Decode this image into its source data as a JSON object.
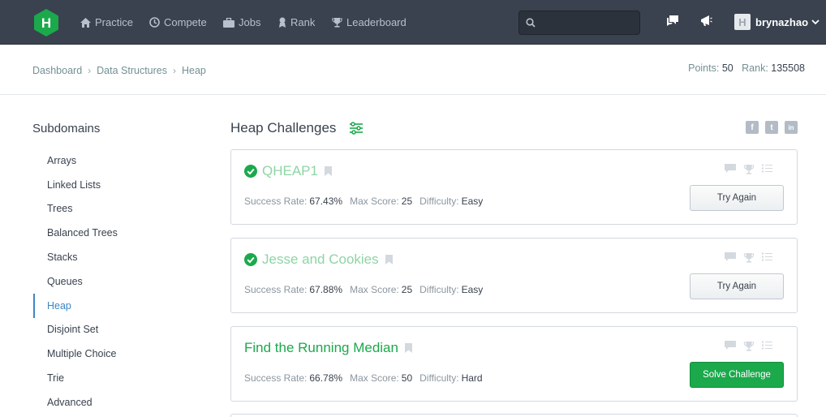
{
  "nav": {
    "logo_letter": "H",
    "items": [
      {
        "label": "Practice",
        "icon": "home-icon"
      },
      {
        "label": "Compete",
        "icon": "clock-icon"
      },
      {
        "label": "Jobs",
        "icon": "briefcase-icon"
      },
      {
        "label": "Rank",
        "icon": "rank-icon"
      },
      {
        "label": "Leaderboard",
        "icon": "trophy-icon"
      }
    ],
    "search_placeholder": "",
    "username": "brynazhao"
  },
  "breadcrumb": [
    "Dashboard",
    "Data Structures",
    "Heap"
  ],
  "stats": {
    "points_label": "Points:",
    "points": "50",
    "rank_label": "Rank:",
    "rank": "135508"
  },
  "sidebar": {
    "title": "Subdomains",
    "items": [
      "Arrays",
      "Linked Lists",
      "Trees",
      "Balanced Trees",
      "Stacks",
      "Queues",
      "Heap",
      "Disjoint Set",
      "Multiple Choice",
      "Trie",
      "Advanced"
    ],
    "active": "Heap"
  },
  "main": {
    "title": "Heap Challenges",
    "share": [
      "f",
      "t",
      "in"
    ],
    "labels": {
      "success_rate": "Success Rate:",
      "max_score": "Max Score:",
      "difficulty": "Difficulty:"
    },
    "challenges": [
      {
        "name": "QHEAP1",
        "solved": true,
        "success_rate": "67.43%",
        "max_score": "25",
        "difficulty": "Easy",
        "button": "Try Again"
      },
      {
        "name": "Jesse and Cookies",
        "solved": true,
        "success_rate": "67.88%",
        "max_score": "25",
        "difficulty": "Easy",
        "button": "Try Again"
      },
      {
        "name": "Find the Running Median",
        "solved": false,
        "success_rate": "66.78%",
        "max_score": "50",
        "difficulty": "Hard",
        "button": "Solve Challenge"
      }
    ]
  },
  "colors": {
    "nav_bg": "#39424e",
    "accent_green": "#1ba94c",
    "active_blue": "#3d86c6"
  }
}
